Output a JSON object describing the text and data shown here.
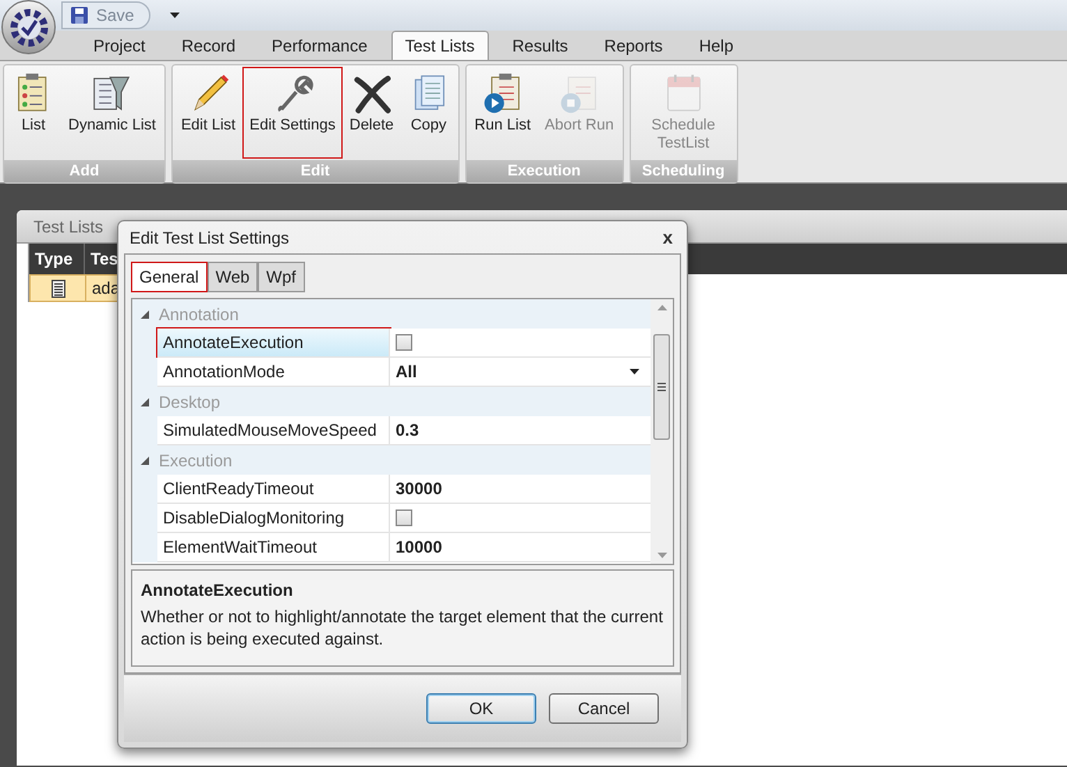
{
  "title_bar": {
    "save_label": "Save",
    "save_disabled": true
  },
  "tabs": [
    {
      "label": "Project",
      "selected": false
    },
    {
      "label": "Record",
      "selected": false
    },
    {
      "label": "Performance",
      "selected": false
    },
    {
      "label": "Test Lists",
      "selected": true
    },
    {
      "label": "Results",
      "selected": false
    },
    {
      "label": "Reports",
      "selected": false
    },
    {
      "label": "Help",
      "selected": false
    }
  ],
  "ribbon_groups": [
    {
      "label": "Add",
      "buttons": [
        {
          "label": "List",
          "disabled": false,
          "highlighted": false
        },
        {
          "label": "Dynamic List",
          "disabled": false,
          "highlighted": false
        }
      ]
    },
    {
      "label": "Edit",
      "buttons": [
        {
          "label": "Edit List",
          "disabled": false,
          "highlighted": false
        },
        {
          "label": "Edit Settings",
          "disabled": false,
          "highlighted": true
        },
        {
          "label": "Delete",
          "disabled": false,
          "highlighted": false
        },
        {
          "label": "Copy",
          "disabled": false,
          "highlighted": false
        }
      ]
    },
    {
      "label": "Execution",
      "buttons": [
        {
          "label": "Run List",
          "disabled": false,
          "highlighted": false
        },
        {
          "label": "Abort Run",
          "disabled": true,
          "highlighted": false
        }
      ]
    },
    {
      "label": "Scheduling",
      "buttons": [
        {
          "label": "Schedule TestList",
          "disabled": true,
          "highlighted": false
        }
      ]
    }
  ],
  "panel": {
    "title": "Test Lists",
    "columns": [
      "Type",
      "Tes"
    ],
    "rows": [
      {
        "cells": [
          "",
          "ada"
        ],
        "selected": true
      }
    ]
  },
  "dialog": {
    "title": "Edit Test List Settings",
    "close": "x",
    "tabs": [
      {
        "label": "General",
        "selected": true,
        "highlighted": true
      },
      {
        "label": "Web",
        "selected": false,
        "highlighted": false
      },
      {
        "label": "Wpf",
        "selected": false,
        "highlighted": false
      }
    ],
    "categories": [
      {
        "name": "Annotation",
        "expanded": true,
        "properties": [
          {
            "name": "AnnotateExecution",
            "kind": "checkbox",
            "checked": false,
            "selected": true,
            "highlighted": true
          },
          {
            "name": "AnnotationMode",
            "kind": "dropdown",
            "value": "All",
            "selected": false,
            "highlighted": false
          }
        ]
      },
      {
        "name": "Desktop",
        "expanded": true,
        "properties": [
          {
            "name": "SimulatedMouseMoveSpeed",
            "kind": "text",
            "value": "0.3",
            "selected": false,
            "highlighted": false
          }
        ]
      },
      {
        "name": "Execution",
        "expanded": true,
        "properties": [
          {
            "name": "ClientReadyTimeout",
            "kind": "text",
            "value": "30000",
            "selected": false,
            "highlighted": false
          },
          {
            "name": "DisableDialogMonitoring",
            "kind": "checkbox",
            "checked": false,
            "selected": false,
            "highlighted": false
          },
          {
            "name": "ElementWaitTimeout",
            "kind": "text",
            "value": "10000",
            "selected": false,
            "highlighted": false
          }
        ]
      }
    ],
    "description": {
      "title": "AnnotateExecution",
      "text": "Whether or not to highlight/annotate the target element that the current action is being executed against."
    },
    "buttons": [
      {
        "label": "OK",
        "default": true
      },
      {
        "label": "Cancel",
        "default": false
      }
    ]
  }
}
